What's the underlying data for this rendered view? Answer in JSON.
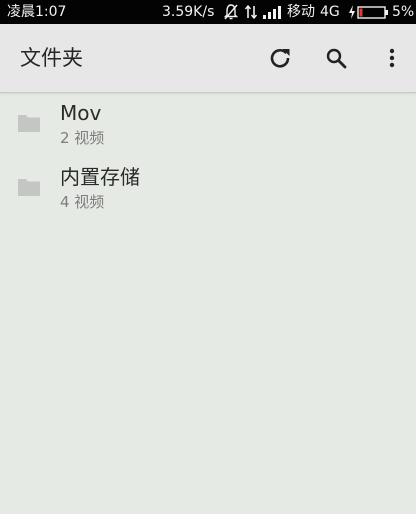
{
  "status_bar": {
    "time": "凌晨1:07",
    "speed": "3.59K/s",
    "carrier": "移动",
    "network": "4G",
    "battery_percent": "5%"
  },
  "toolbar": {
    "title": "文件夹",
    "refresh_icon": "refresh-icon",
    "search_icon": "search-icon",
    "more_icon": "more-vert-icon"
  },
  "folders": [
    {
      "name": "Mov",
      "count": "2 视频",
      "icon": "folder-icon"
    },
    {
      "name": "内置存储",
      "count": "4 视频",
      "icon": "folder-icon"
    }
  ],
  "colors": {
    "status_bar_bg": "#030303",
    "toolbar_bg": "#e7e7e7",
    "content_bg": "#e6eae4",
    "folder_icon": "#c4c6c3"
  }
}
